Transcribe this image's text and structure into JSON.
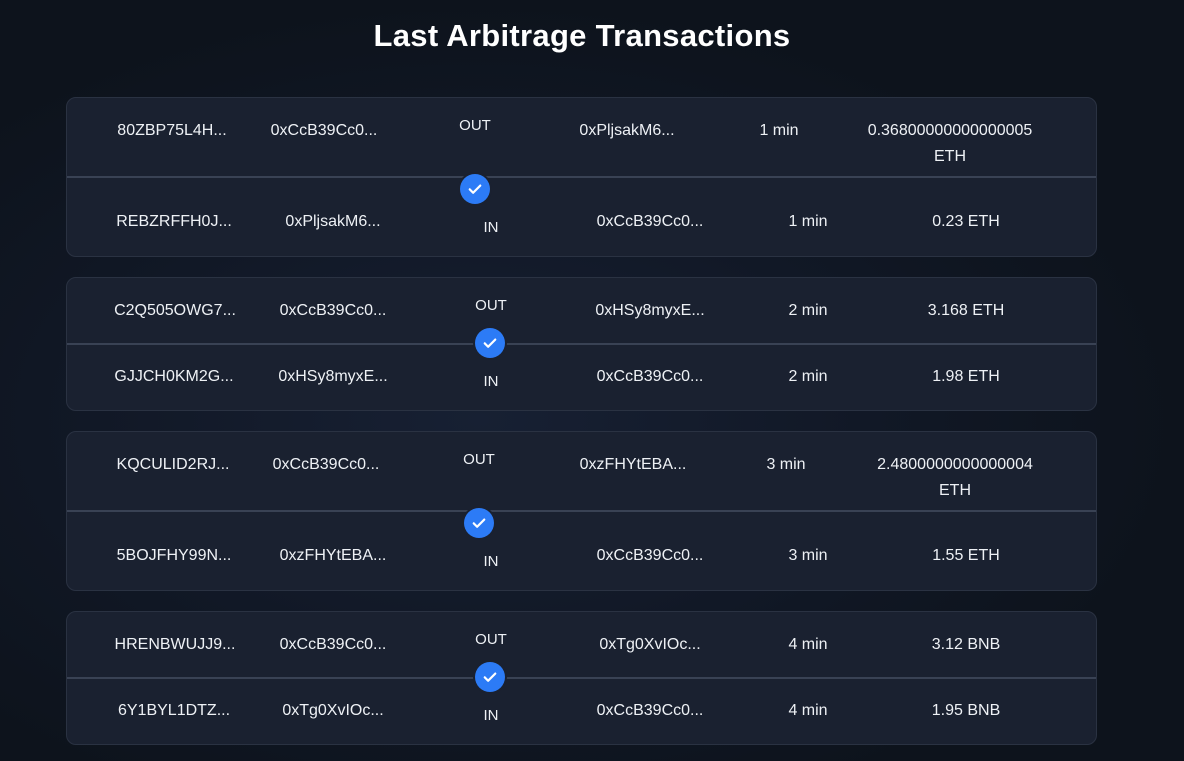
{
  "page": {
    "title": "Last Arbitrage Transactions"
  },
  "transactions": [
    {
      "out": {
        "id": "80ZBP75L4H...",
        "from": "0xCcB39Cc0...",
        "direction": "OUT",
        "to": "0xPljsakM6...",
        "time": "1 min",
        "amount": "0.36800000000000005 ETH"
      },
      "in": {
        "id": "REBZRFFH0J...",
        "from": "0xPljsakM6...",
        "direction": "IN",
        "to": "0xCcB39Cc0...",
        "time": "1 min",
        "amount": "0.23 ETH"
      }
    },
    {
      "out": {
        "id": "C2Q505OWG7...",
        "from": "0xCcB39Cc0...",
        "direction": "OUT",
        "to": "0xHSy8myxE...",
        "time": "2 min",
        "amount": "3.168 ETH"
      },
      "in": {
        "id": "GJJCH0KM2G...",
        "from": "0xHSy8myxE...",
        "direction": "IN",
        "to": "0xCcB39Cc0...",
        "time": "2 min",
        "amount": "1.98 ETH"
      }
    },
    {
      "out": {
        "id": "KQCULID2RJ...",
        "from": "0xCcB39Cc0...",
        "direction": "OUT",
        "to": "0xzFHYtEBA...",
        "time": "3 min",
        "amount": "2.4800000000000004 ETH"
      },
      "in": {
        "id": "5BOJFHY99N...",
        "from": "0xzFHYtEBA...",
        "direction": "IN",
        "to": "0xCcB39Cc0...",
        "time": "3 min",
        "amount": "1.55 ETH"
      }
    },
    {
      "out": {
        "id": "HRENBWUJJ9...",
        "from": "0xCcB39Cc0...",
        "direction": "OUT",
        "to": "0xTg0XvIOc...",
        "time": "4 min",
        "amount": "3.12 BNB"
      },
      "in": {
        "id": "6Y1BYL1DTZ...",
        "from": "0xTg0XvIOc...",
        "direction": "IN",
        "to": "0xCcB39Cc0...",
        "time": "4 min",
        "amount": "1.95 BNB"
      }
    }
  ],
  "icons": {
    "status": "check-circle-icon"
  },
  "colors": {
    "background": "#0d131c",
    "card": "#1a2130",
    "divider": "#394254",
    "accent": "#2c7bf6"
  }
}
